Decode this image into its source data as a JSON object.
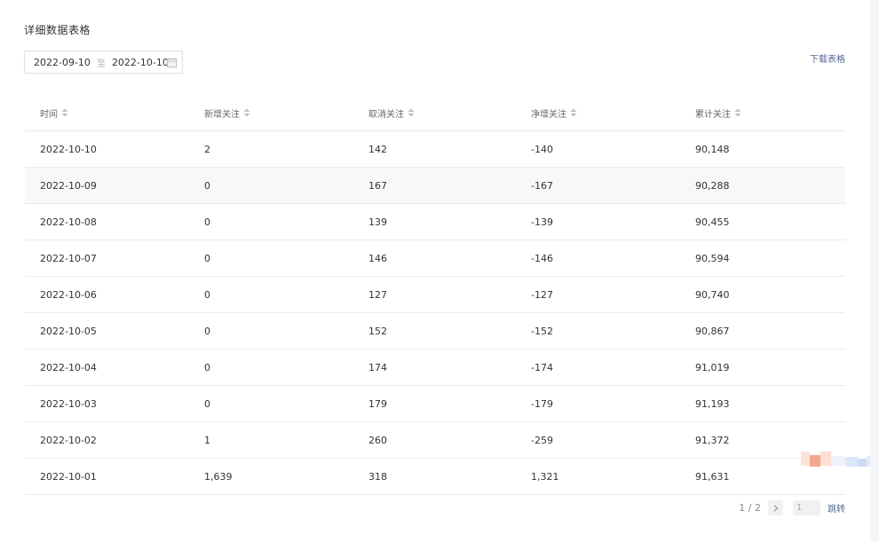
{
  "section": {
    "title": "详细数据表格"
  },
  "date_range": {
    "start": "2022-09-10",
    "separator": "至",
    "end": "2022-10-10",
    "icon": "calendar-icon"
  },
  "toolbar": {
    "download_label": "下载表格"
  },
  "table": {
    "headers": [
      "时间",
      "新增关注",
      "取消关注",
      "净增关注",
      "累计关注"
    ],
    "rows": [
      [
        "2022-10-10",
        "2",
        "142",
        "-140",
        "90,148"
      ],
      [
        "2022-10-09",
        "0",
        "167",
        "-167",
        "90,288"
      ],
      [
        "2022-10-08",
        "0",
        "139",
        "-139",
        "90,455"
      ],
      [
        "2022-10-07",
        "0",
        "146",
        "-146",
        "90,594"
      ],
      [
        "2022-10-06",
        "0",
        "127",
        "-127",
        "90,740"
      ],
      [
        "2022-10-05",
        "0",
        "152",
        "-152",
        "90,867"
      ],
      [
        "2022-10-04",
        "0",
        "174",
        "-174",
        "91,019"
      ],
      [
        "2022-10-03",
        "0",
        "179",
        "-179",
        "91,193"
      ],
      [
        "2022-10-02",
        "1",
        "260",
        "-259",
        "91,372"
      ],
      [
        "2022-10-01",
        "1,639",
        "318",
        "1,321",
        "91,631"
      ]
    ]
  },
  "pagination": {
    "info": "1 / 2",
    "input_value": "1",
    "jump_label": "跳转"
  },
  "colors": {
    "link": "#576b95",
    "row_alt": "#f7f8fa",
    "border": "#ebebeb"
  }
}
